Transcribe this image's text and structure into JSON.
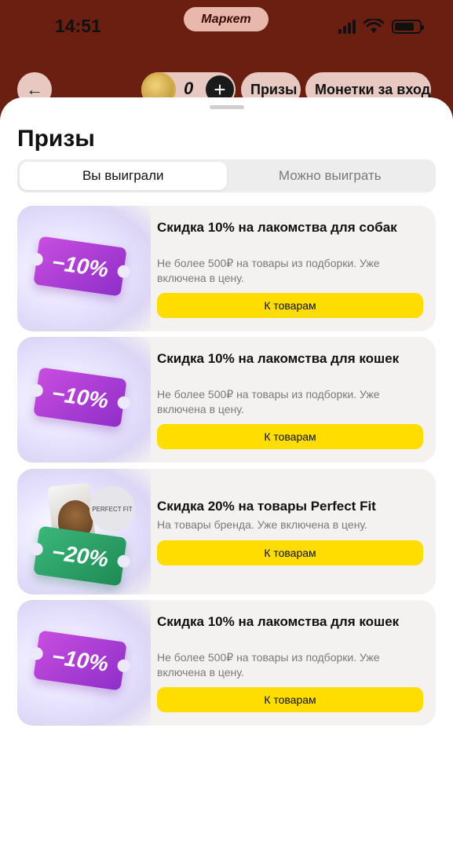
{
  "status_bar": {
    "time": "14:51",
    "app_name": "Маркет"
  },
  "topbar": {
    "coin_count": "0",
    "prizes_label": "Призы",
    "coins_label": "Монетки за вход"
  },
  "sheet": {
    "title": "Призы",
    "tabs": [
      {
        "label": "Вы выиграли",
        "active": true
      },
      {
        "label": "Можно выиграть",
        "active": false
      }
    ]
  },
  "cards": [
    {
      "title": "Скидка 10% на лакомства для собак",
      "description": "Не более 500₽ на товары из подборки. Уже включена в цену.",
      "badge": "−10%",
      "badge_color": "#b040d8",
      "button": "К товарам"
    },
    {
      "title": "Скидка 10% на лакомства для кошек",
      "description": "Не более 500₽ на товары из подборки. Уже включена в цену.",
      "badge": "−10%",
      "badge_color": "#b040d8",
      "button": "К товарам"
    },
    {
      "title": "Скидка 20% на товары Perfect Fit",
      "description": "На товары бренда. Уже включена в цену.",
      "badge": "−20%",
      "badge_color": "#2ea56a",
      "brand_text": "PERFECT FIT",
      "button": "К товарам"
    },
    {
      "title": "Скидка 10% на лакомства для кошек",
      "description": "Не более 500₽ на товары из подборки. Уже включена в цену.",
      "badge": "−10%",
      "badge_color": "#b040d8",
      "button": "К товарам"
    }
  ],
  "colors": {
    "background": "#6b1f10",
    "accent_yellow": "#ffdd00"
  },
  "icons": [
    "back-arrow-icon",
    "coin-icon",
    "plus-icon",
    "signal-icon",
    "wifi-icon",
    "battery-icon"
  ]
}
